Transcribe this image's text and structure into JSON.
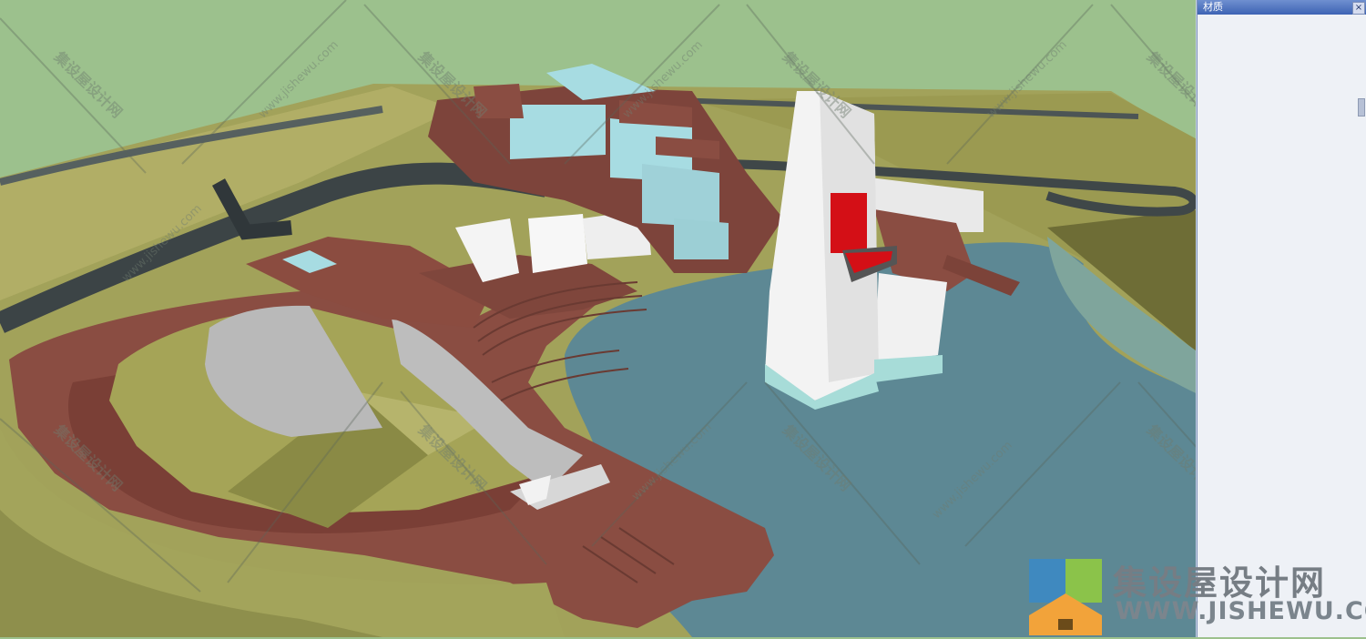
{
  "material_panel": {
    "title": "材质",
    "close_glyph": "×"
  },
  "watermark": {
    "brand_text": "集设屋设计网",
    "brand_url": "WWW.JISHEWU.COM",
    "tile_text": "集设屋设计网",
    "tile_url": "www.jishewu.com"
  },
  "colors": {
    "sky": "#9cc18d",
    "terrain": "#a5a457",
    "brick": "#8a4d42",
    "water": "#5c8593",
    "tower": "#f1f1f1",
    "accent_red": "#d40f16",
    "glass": "#a7dce2"
  },
  "icons": [
    "close-icon",
    "logo-icon"
  ]
}
